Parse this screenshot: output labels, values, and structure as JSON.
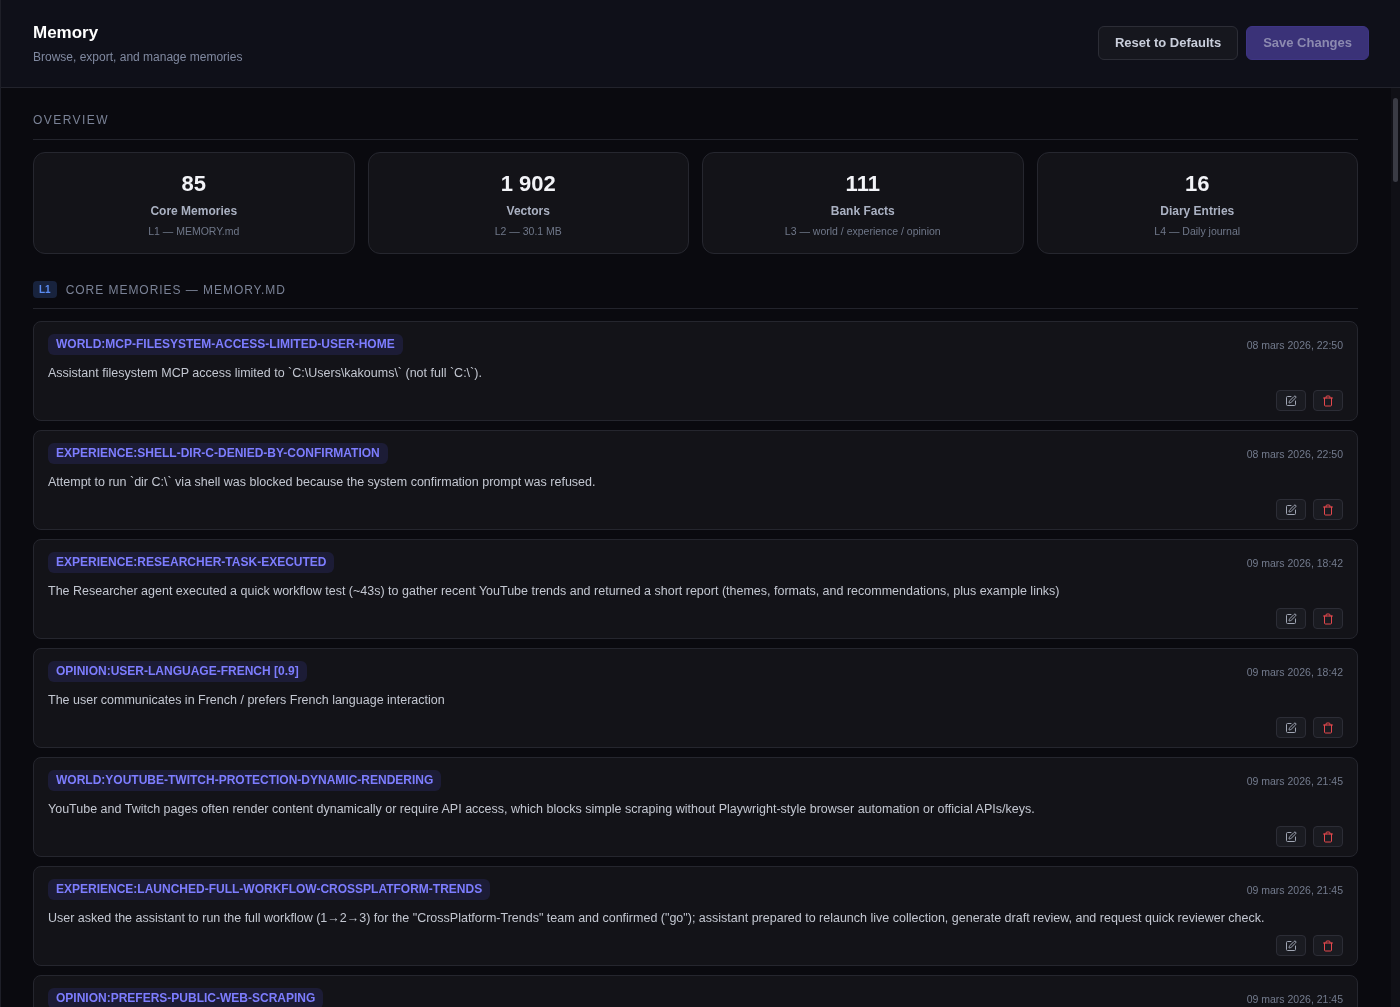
{
  "header": {
    "title": "Memory",
    "subtitle": "Browse, export, and manage memories",
    "buttons": [
      {
        "label": "Reset to Defaults",
        "kind": "secondary",
        "disabled": false
      },
      {
        "label": "Save Changes",
        "kind": "primary",
        "disabled": true
      }
    ]
  },
  "overview": {
    "heading": "OVERVIEW",
    "stats": [
      {
        "value": "85",
        "label": "Core Memories",
        "detail": "L1 — MEMORY.md"
      },
      {
        "value": "1 902",
        "label": "Vectors",
        "detail": "L2 — 30.1 MB"
      },
      {
        "value": "111",
        "label": "Bank Facts",
        "detail": "L3 — world / experience / opinion"
      },
      {
        "value": "16",
        "label": "Diary Entries",
        "detail": "L4 — Daily journal"
      }
    ]
  },
  "section": {
    "badge": "L1",
    "heading": "CORE MEMORIES — MEMORY.MD",
    "memories": [
      {
        "tag": "WORLD:MCP-FILESYSTEM-ACCESS-LIMITED-USER-HOME",
        "date": "08 mars 2026, 22:50",
        "text": "Assistant filesystem MCP access limited to `C:\\Users\\kakoums\\` (not full `C:\\`)."
      },
      {
        "tag": "EXPERIENCE:SHELL-DIR-C-DENIED-BY-CONFIRMATION",
        "date": "08 mars 2026, 22:50",
        "text": "Attempt to run `dir C:\\` via shell was blocked because the system confirmation prompt was refused."
      },
      {
        "tag": "EXPERIENCE:RESEARCHER-TASK-EXECUTED",
        "date": "09 mars 2026, 18:42",
        "text": "The Researcher agent executed a quick workflow test (~43s) to gather recent YouTube trends and returned a short report (themes, formats, and recommendations, plus example links)"
      },
      {
        "tag": "OPINION:USER-LANGUAGE-FRENCH [0.9]",
        "date": "09 mars 2026, 18:42",
        "text": "The user communicates in French / prefers French language interaction"
      },
      {
        "tag": "WORLD:YOUTUBE-TWITCH-PROTECTION-DYNAMIC-RENDERING",
        "date": "09 mars 2026, 21:45",
        "text": "YouTube and Twitch pages often render content dynamically or require API access, which blocks simple scraping without Playwright-style browser automation or official APIs/keys."
      },
      {
        "tag": "EXPERIENCE:LAUNCHED-FULL-WORKFLOW-CROSSPLATFORM-TRENDS",
        "date": "09 mars 2026, 21:45",
        "text": "User asked the assistant to run the full workflow (1→2→3) for the \"CrossPlatform-Trends\" team and confirmed (\"go\"); assistant prepared to relaunch live collection, generate draft review, and request quick reviewer check."
      },
      {
        "tag": "OPINION:PREFERS-PUBLIC-WEB-SCRAPING",
        "date": "09 mars 2026, 21:45"
      }
    ]
  }
}
